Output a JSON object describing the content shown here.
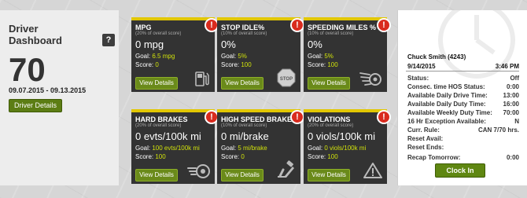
{
  "dashboard": {
    "title": "Driver Dashboard",
    "help_label": "?",
    "score": "70",
    "date_range": "09.07.2015 - 09.13.2015",
    "details_button": "Driver Details"
  },
  "cards": [
    {
      "title": "MPG",
      "subtitle": "(20% of overall score)",
      "value": "0 mpg",
      "goal_label": "Goal:",
      "goal": "6.5 mpg",
      "score_label": "Score:",
      "score": "0",
      "button": "View Details",
      "alert": "!",
      "icon": "fuel-pump-icon"
    },
    {
      "title": "STOP IDLE%",
      "subtitle": "(10% of overall score)",
      "value": "0%",
      "goal_label": "Goal:",
      "goal": "5%",
      "score_label": "Score:",
      "score": "100",
      "button": "View Details",
      "alert": "!",
      "icon": "stop-sign-icon",
      "icon_text": "STOP"
    },
    {
      "title": "SPEEDING MILES %",
      "subtitle": "(10% of overall score)",
      "value": "0%",
      "goal_label": "Goal:",
      "goal": "5%",
      "score_label": "Score:",
      "score": "100",
      "button": "View Details",
      "alert": "!",
      "icon": "winged-wheel-icon"
    },
    {
      "title": "HARD BRAKES",
      "subtitle": "(20% of overall score)",
      "value": "0 evts/100k mi",
      "goal_label": "Goal:",
      "goal": "100 evts/100k mi",
      "score_label": "Score:",
      "score": "100",
      "button": "View Details",
      "alert": "!",
      "icon": "brake-disc-icon"
    },
    {
      "title": "HIGH SPEED BRAKES",
      "subtitle": "(10% of overall score)",
      "value": "0 mi/brake",
      "goal_label": "Goal:",
      "goal": "5 mi/brake",
      "score_label": "Score:",
      "score": "0",
      "button": "View Details",
      "alert": "!",
      "icon": "brake-pedal-icon"
    },
    {
      "title": "VIOLATIONS",
      "subtitle": "(20% of overall score)",
      "value": "0 viols/100k mi",
      "goal_label": "Goal:",
      "goal": "0 viols/100k mi",
      "score_label": "Score:",
      "score": "100",
      "button": "View Details",
      "alert": "!",
      "icon": "warning-triangle-icon"
    }
  ],
  "hos": {
    "driver_name": "Chuck Smith (4243)",
    "date": "9/14/2015",
    "time": "3:46 PM",
    "rows": [
      {
        "label": "Status:",
        "value": "Off"
      },
      {
        "label": "Consec. time HOS Status:",
        "value": "0:00"
      },
      {
        "label": "Available Daily Drive Time:",
        "value": "13:00"
      },
      {
        "label": "Available Daily Duty Time:",
        "value": "16:00"
      },
      {
        "label": "Available Weekly Duty Time:",
        "value": "70:00"
      },
      {
        "label": "16 Hr Exception Available:",
        "value": "N"
      },
      {
        "label": "Curr. Rule:",
        "value": "CAN 7/70 hrs."
      },
      {
        "label": "Reset Avail:",
        "value": ""
      },
      {
        "label": "Reset Ends:",
        "value": ""
      },
      {
        "label": "Recap Tomorrow:",
        "value": "0:00"
      }
    ],
    "clock_in_button": "Clock In"
  },
  "colors": {
    "accent_yellow": "#e2c700",
    "alert_red": "#d92b1e",
    "button_green": "#5f8712",
    "card_bg": "#333333"
  }
}
